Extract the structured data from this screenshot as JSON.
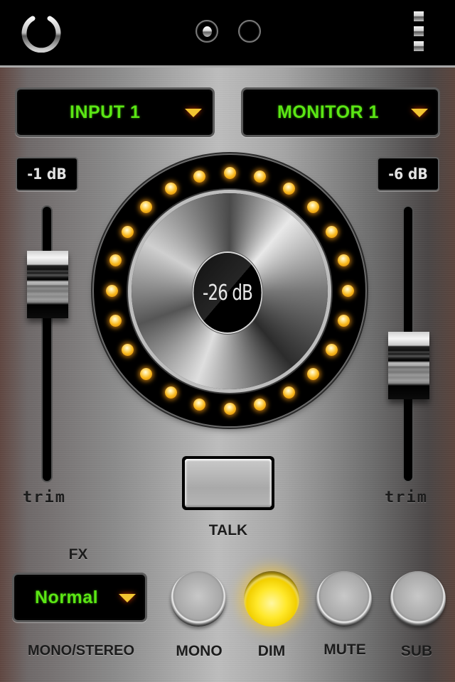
{
  "topbar": {
    "power_icon": "power-icon",
    "pages": [
      {
        "active": true
      },
      {
        "active": false
      }
    ],
    "menu_icon": "menu-icon"
  },
  "input_select": {
    "label": "INPUT 1",
    "icon": "dropdown-arrow-icon"
  },
  "monitor_select": {
    "label": "MONITOR 1",
    "icon": "dropdown-arrow-icon"
  },
  "left_fader": {
    "value_label": "-1 dB",
    "label": "trim",
    "level": 0.8
  },
  "right_fader": {
    "value_label": "-6 dB",
    "label": "trim",
    "level": 0.4
  },
  "volume_knob": {
    "readout": "-26 dB",
    "led_count": 24,
    "leds_lit": 24,
    "led_color": "#f8b71c"
  },
  "talk": {
    "label": "TALK",
    "active": false
  },
  "fx": {
    "title": "FX",
    "value": "Normal",
    "caption": "MONO/STEREO",
    "icon": "dropdown-arrow-icon"
  },
  "buttons": [
    {
      "id": "mono",
      "label": "MONO",
      "active": false
    },
    {
      "id": "dim",
      "label": "DIM",
      "active": true
    },
    {
      "id": "mute",
      "label": "MUTE",
      "active": false
    },
    {
      "id": "sub",
      "label": "SUB",
      "active": false
    }
  ],
  "colors": {
    "lcd_text": "#5be614",
    "arrow": "#f2c531",
    "led": "#f8b71c",
    "dim_on": "#ffe82a"
  }
}
